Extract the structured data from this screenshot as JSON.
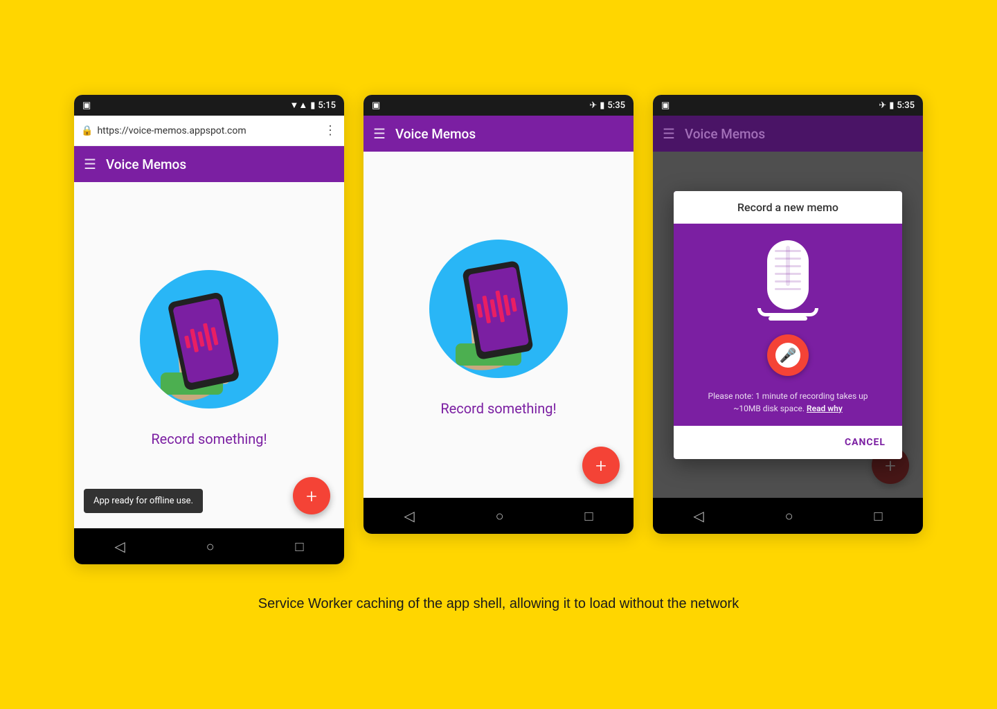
{
  "background_color": "#FFD600",
  "caption": "Service Worker caching of the app shell, allowing it to load without the network",
  "phone1": {
    "status": {
      "left_icon": "tablet-icon",
      "wifi": "▼",
      "signal": "▲",
      "battery": "🔋",
      "time": "5:15"
    },
    "url_bar": {
      "lock_icon": "🔒",
      "url": "https://voice-memos.appspot.com",
      "dots": "⋮"
    },
    "app_bar": {
      "menu_icon": "☰",
      "title": "Voice Memos"
    },
    "content": {
      "record_label": "Record something!",
      "fab_label": "+"
    },
    "snackbar": {
      "text": "App ready for offline use."
    },
    "nav": {
      "back": "◁",
      "home": "○",
      "recent": "□"
    }
  },
  "phone2": {
    "status": {
      "left_icon": "tablet-icon",
      "airplane": "✈",
      "battery": "🔋",
      "time": "5:35"
    },
    "app_bar": {
      "menu_icon": "☰",
      "title": "Voice Memos"
    },
    "content": {
      "record_label": "Record something!",
      "fab_label": "+"
    },
    "nav": {
      "back": "◁",
      "home": "○",
      "recent": "□"
    }
  },
  "phone3": {
    "status": {
      "left_icon": "tablet-icon",
      "airplane": "✈",
      "battery": "🔋",
      "time": "5:35"
    },
    "app_bar": {
      "menu_icon": "☰",
      "title": "Voice Memos"
    },
    "dialog": {
      "title": "Record a new memo",
      "note": "Please note: 1 minute of recording takes up ~10MB disk space.",
      "read_why": "Read why",
      "cancel": "CANCEL"
    },
    "fab_label": "+",
    "nav": {
      "back": "◁",
      "home": "○",
      "recent": "□"
    }
  }
}
